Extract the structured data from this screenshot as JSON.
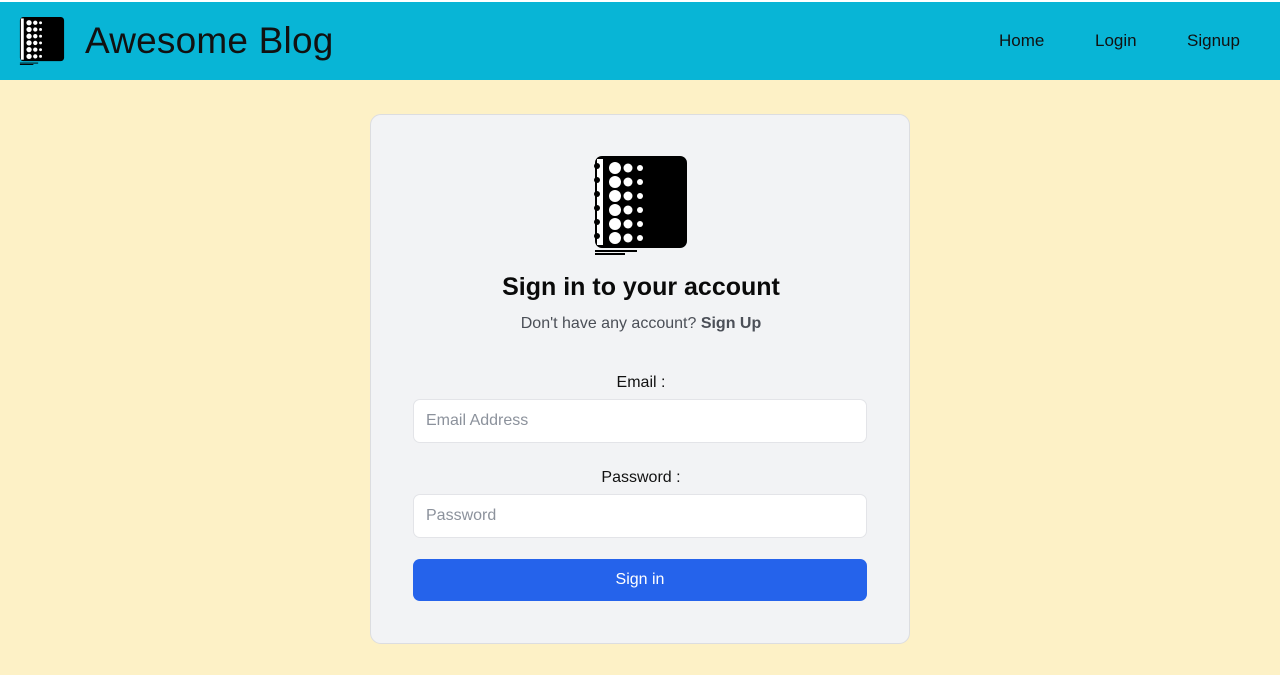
{
  "navbar": {
    "brand_title": "Awesome Blog",
    "background_color": "#08b5d6",
    "links": [
      {
        "label": "Home"
      },
      {
        "label": "Login"
      },
      {
        "label": "Signup"
      }
    ]
  },
  "page": {
    "background_color": "#fdf1c6"
  },
  "signin_card": {
    "logo_icon": "perforated-block-logo-icon",
    "title": "Sign in to your account",
    "subtitle_text": "Don't have any account?",
    "subtitle_link": "Sign Up",
    "email_label": "Email :",
    "email_placeholder": "Email Address",
    "email_value": "",
    "password_label": "Password :",
    "password_placeholder": "Password",
    "password_value": "",
    "submit_label": "Sign in",
    "submit_color": "#2563eb"
  }
}
